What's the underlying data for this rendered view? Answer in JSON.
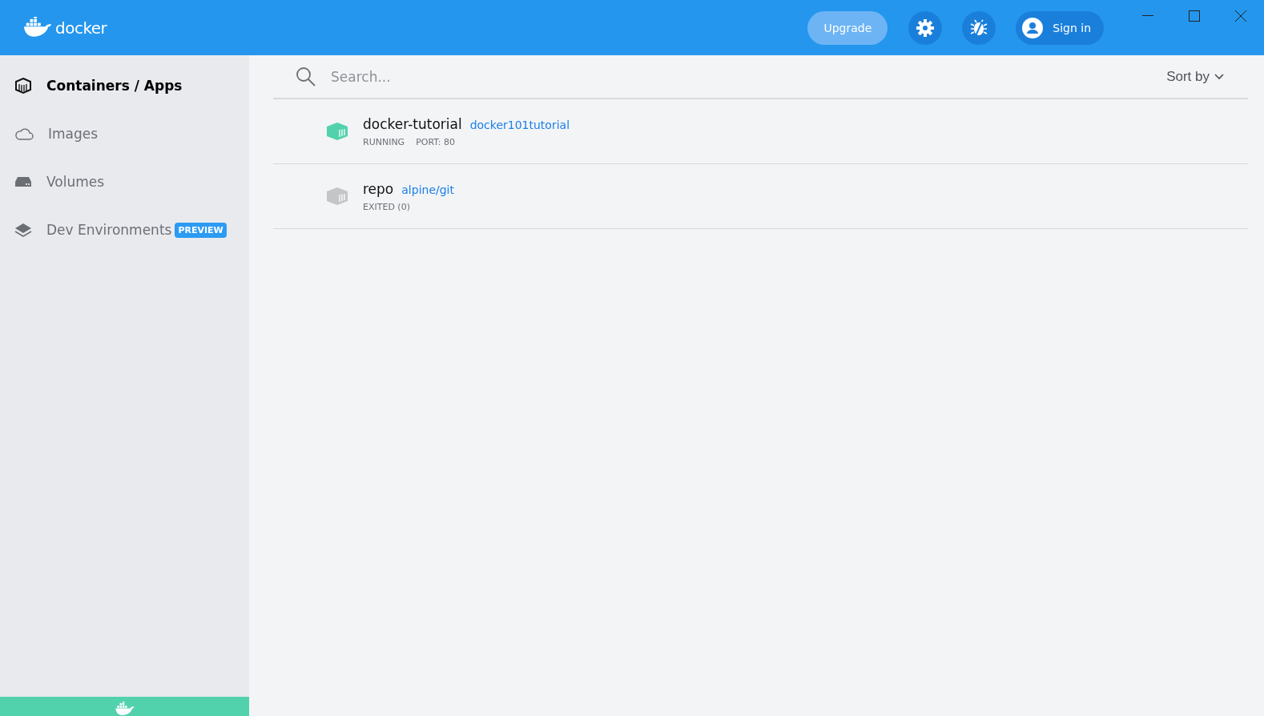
{
  "header": {
    "logo": "docker",
    "upgrade": "Upgrade",
    "sign_in": "Sign in"
  },
  "sidebar": {
    "items": [
      {
        "label": "Containers / Apps",
        "selected": true,
        "kind": "containers"
      },
      {
        "label": "Images",
        "selected": false,
        "kind": "images"
      },
      {
        "label": "Volumes",
        "selected": false,
        "kind": "volumes"
      },
      {
        "label": "Dev Environments",
        "selected": false,
        "kind": "dev",
        "badge": "PREVIEW"
      }
    ]
  },
  "search": {
    "placeholder": "Search...",
    "sort": "Sort by"
  },
  "containers": [
    {
      "name": "docker-tutorial",
      "image": "docker101tutorial",
      "running": true,
      "status": [
        "RUNNING",
        "PORT: 80"
      ]
    },
    {
      "name": "repo",
      "image": "alpine/git",
      "running": false,
      "status": [
        "EXITED (0)"
      ]
    }
  ]
}
